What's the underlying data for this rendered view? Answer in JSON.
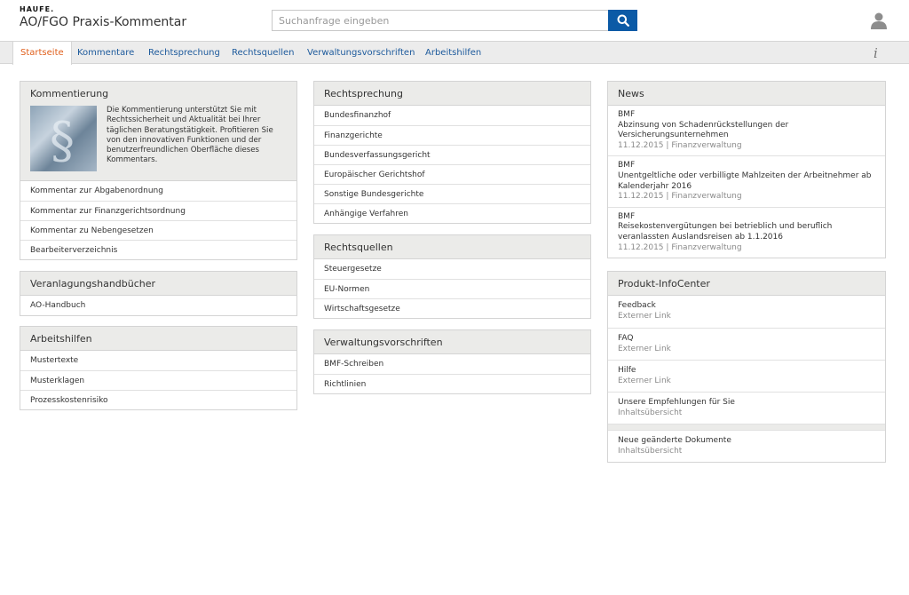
{
  "header": {
    "brand": "HAUFE.",
    "app_title": "AO/FGO Praxis-Kommentar",
    "search_placeholder": "Suchanfrage eingeben"
  },
  "nav": {
    "tabs": [
      {
        "label": "Startseite",
        "active": true
      },
      {
        "label": "Kommentare"
      },
      {
        "label": "Rechtsprechung"
      },
      {
        "label": "Rechtsquellen"
      },
      {
        "label": "Verwaltungsvorschriften"
      },
      {
        "label": "Arbeitshilfen"
      }
    ],
    "info_glyph": "i"
  },
  "kommentierung": {
    "title": "Kommentierung",
    "intro": "Die Kommentierung unterstützt Sie mit Rechtssicherheit und Aktualität bei Ihrer täglichen Beratungstätigkeit. Profitieren Sie von den innovativen Funktionen und der benutzerfreundlichen Oberfläche dieses Kommentars.",
    "items": [
      "Kommentar zur Abgabenordnung",
      "Kommentar zur Finanzgerichtsordnung",
      "Kommentar zu Nebengesetzen",
      "Bearbeiterverzeichnis"
    ]
  },
  "veranlagung": {
    "title": "Veranlagungshandbücher",
    "items": [
      "AO-Handbuch"
    ]
  },
  "arbeitshilfen": {
    "title": "Arbeitshilfen",
    "items": [
      "Mustertexte",
      "Musterklagen",
      "Prozesskostenrisiko"
    ]
  },
  "rechtsprechung": {
    "title": "Rechtsprechung",
    "items": [
      "Bundesfinanzhof",
      "Finanzgerichte",
      "Bundesverfassungsgericht",
      "Europäischer Gerichtshof",
      "Sonstige Bundesgerichte",
      "Anhängige Verfahren"
    ]
  },
  "rechtsquellen": {
    "title": "Rechtsquellen",
    "items": [
      "Steuergesetze",
      "EU-Normen",
      "Wirtschaftsgesetze"
    ]
  },
  "verwaltung": {
    "title": "Verwaltungsvorschriften",
    "items": [
      "BMF-Schreiben",
      "Richtlinien"
    ]
  },
  "news": {
    "title": "News",
    "items": [
      {
        "source": "BMF",
        "headline": "Abzinsung von Schadenrückstellungen der Versicherungsunternehmen",
        "date": "11.12.2015",
        "category": "Finanzverwaltung"
      },
      {
        "source": "BMF",
        "headline": "Unentgeltliche oder verbilligte Mahlzeiten der Arbeitnehmer ab Kalenderjahr 2016",
        "date": "11.12.2015",
        "category": "Finanzverwaltung"
      },
      {
        "source": "BMF",
        "headline": "Reisekostenvergütungen bei betrieblich und beruflich veranlassten Auslandsreisen ab 1.1.2016",
        "date": "11.12.2015",
        "category": "Finanzverwaltung"
      }
    ],
    "separator": "|"
  },
  "infocenter": {
    "title": "Produkt-InfoCenter",
    "items": [
      {
        "label": "Feedback",
        "sub": "Externer Link"
      },
      {
        "label": "FAQ",
        "sub": "Externer Link"
      },
      {
        "label": "Hilfe",
        "sub": "Externer Link"
      },
      {
        "label": "Unsere Empfehlungen für Sie",
        "sub": "Inhaltsübersicht"
      }
    ],
    "extra": {
      "label": "Neue geänderte Dokumente",
      "sub": "Inhaltsübersicht"
    }
  },
  "colors": {
    "accent_orange": "#e0601d",
    "link_blue": "#1d5a9c",
    "search_button": "#0b5aa6",
    "panel_header": "#ebebe9"
  }
}
